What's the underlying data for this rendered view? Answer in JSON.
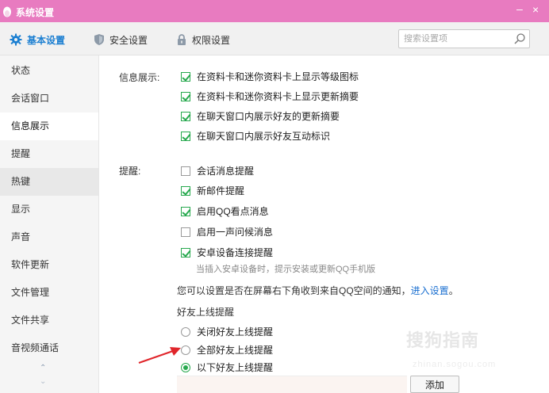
{
  "window": {
    "title": "系统设置",
    "minimize": "–",
    "close": "×"
  },
  "tabs": [
    {
      "label": "基本设置",
      "icon": "gear-icon",
      "active": true
    },
    {
      "label": "安全设置",
      "icon": "shield-icon",
      "active": false
    },
    {
      "label": "权限设置",
      "icon": "lock-icon",
      "active": false
    }
  ],
  "search": {
    "placeholder": "搜索设置项",
    "value": ""
  },
  "sidebar": {
    "items": [
      {
        "label": "状态"
      },
      {
        "label": "会话窗口"
      },
      {
        "label": "信息展示"
      },
      {
        "label": "提醒"
      },
      {
        "label": "热键"
      },
      {
        "label": "显示"
      },
      {
        "label": "声音"
      },
      {
        "label": "软件更新"
      },
      {
        "label": "文件管理"
      },
      {
        "label": "文件共享"
      },
      {
        "label": "音视频通话"
      }
    ],
    "active_index": 2,
    "scroll_up": "⌃",
    "scroll_down": "⌄"
  },
  "info_display": {
    "label": "信息展示:",
    "options": [
      {
        "label": "在资料卡和迷你资料卡上显示等级图标",
        "checked": true
      },
      {
        "label": "在资料卡和迷你资料卡上显示更新摘要",
        "checked": true
      },
      {
        "label": "在聊天窗口内展示好友的更新摘要",
        "checked": true
      },
      {
        "label": "在聊天窗口内展示好友互动标识",
        "checked": true
      }
    ]
  },
  "reminders": {
    "label": "提醒:",
    "options": [
      {
        "label": "会话消息提醒",
        "checked": false
      },
      {
        "label": "新邮件提醒",
        "checked": true
      },
      {
        "label": "启用QQ看点消息",
        "checked": true
      },
      {
        "label": "启用一声问候消息",
        "checked": false
      },
      {
        "label": "安卓设备连接提醒",
        "checked": true
      }
    ],
    "hint": "当插入安卓设备时，提示安装或更新QQ手机版",
    "notice_text": "您可以设置是否在屏幕右下角收到来自QQ空间的通知，",
    "notice_link": "进入设置",
    "notice_end": "。"
  },
  "friend_online": {
    "title": "好友上线提醒",
    "options": [
      {
        "label": "关闭好友上线提醒",
        "selected": false
      },
      {
        "label": "全部好友上线提醒",
        "selected": false
      },
      {
        "label": "以下好友上线提醒",
        "selected": true
      }
    ],
    "add_button": "添加"
  },
  "watermark": {
    "text": "搜狗指南",
    "url": "zhinan.sogou.com"
  },
  "colors": {
    "titlebar": "#e87bc0",
    "accent": "#1a7ed1",
    "check": "#27a94e",
    "link": "#1a6fd0",
    "arrow": "#e0262b"
  }
}
